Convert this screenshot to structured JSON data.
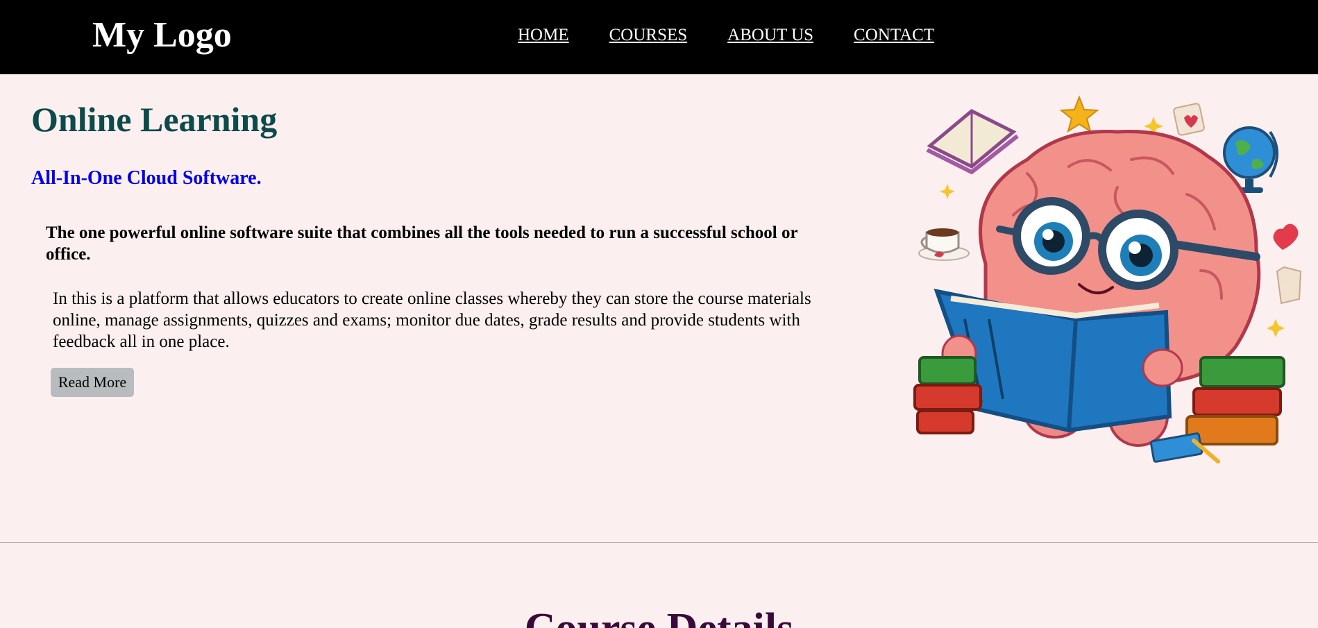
{
  "header": {
    "logo": "My Logo",
    "nav": [
      {
        "label": "HOME"
      },
      {
        "label": "COURSES"
      },
      {
        "label": "ABOUT US"
      },
      {
        "label": "CONTACT"
      }
    ]
  },
  "hero": {
    "title": "Online Learning",
    "subtitle": "All-In-One Cloud Software.",
    "lead": "The one powerful online software suite that combines all the tools needed to run a successful school or office.",
    "body": "In this is a platform that allows educators to create online classes whereby they can store the course materials online, manage assignments, quizzes and exams; monitor due dates, grade results and provide students with feedback all in one place.",
    "button": "Read More",
    "illustration_icon": "brain-reading-book-icon"
  },
  "section": {
    "title": "Course Details"
  },
  "colors": {
    "header_bg": "#000000",
    "page_bg": "#fcefef",
    "title": "#0d4a4a",
    "subtitle": "#0000ee",
    "button_bg": "#b9bcbe"
  }
}
